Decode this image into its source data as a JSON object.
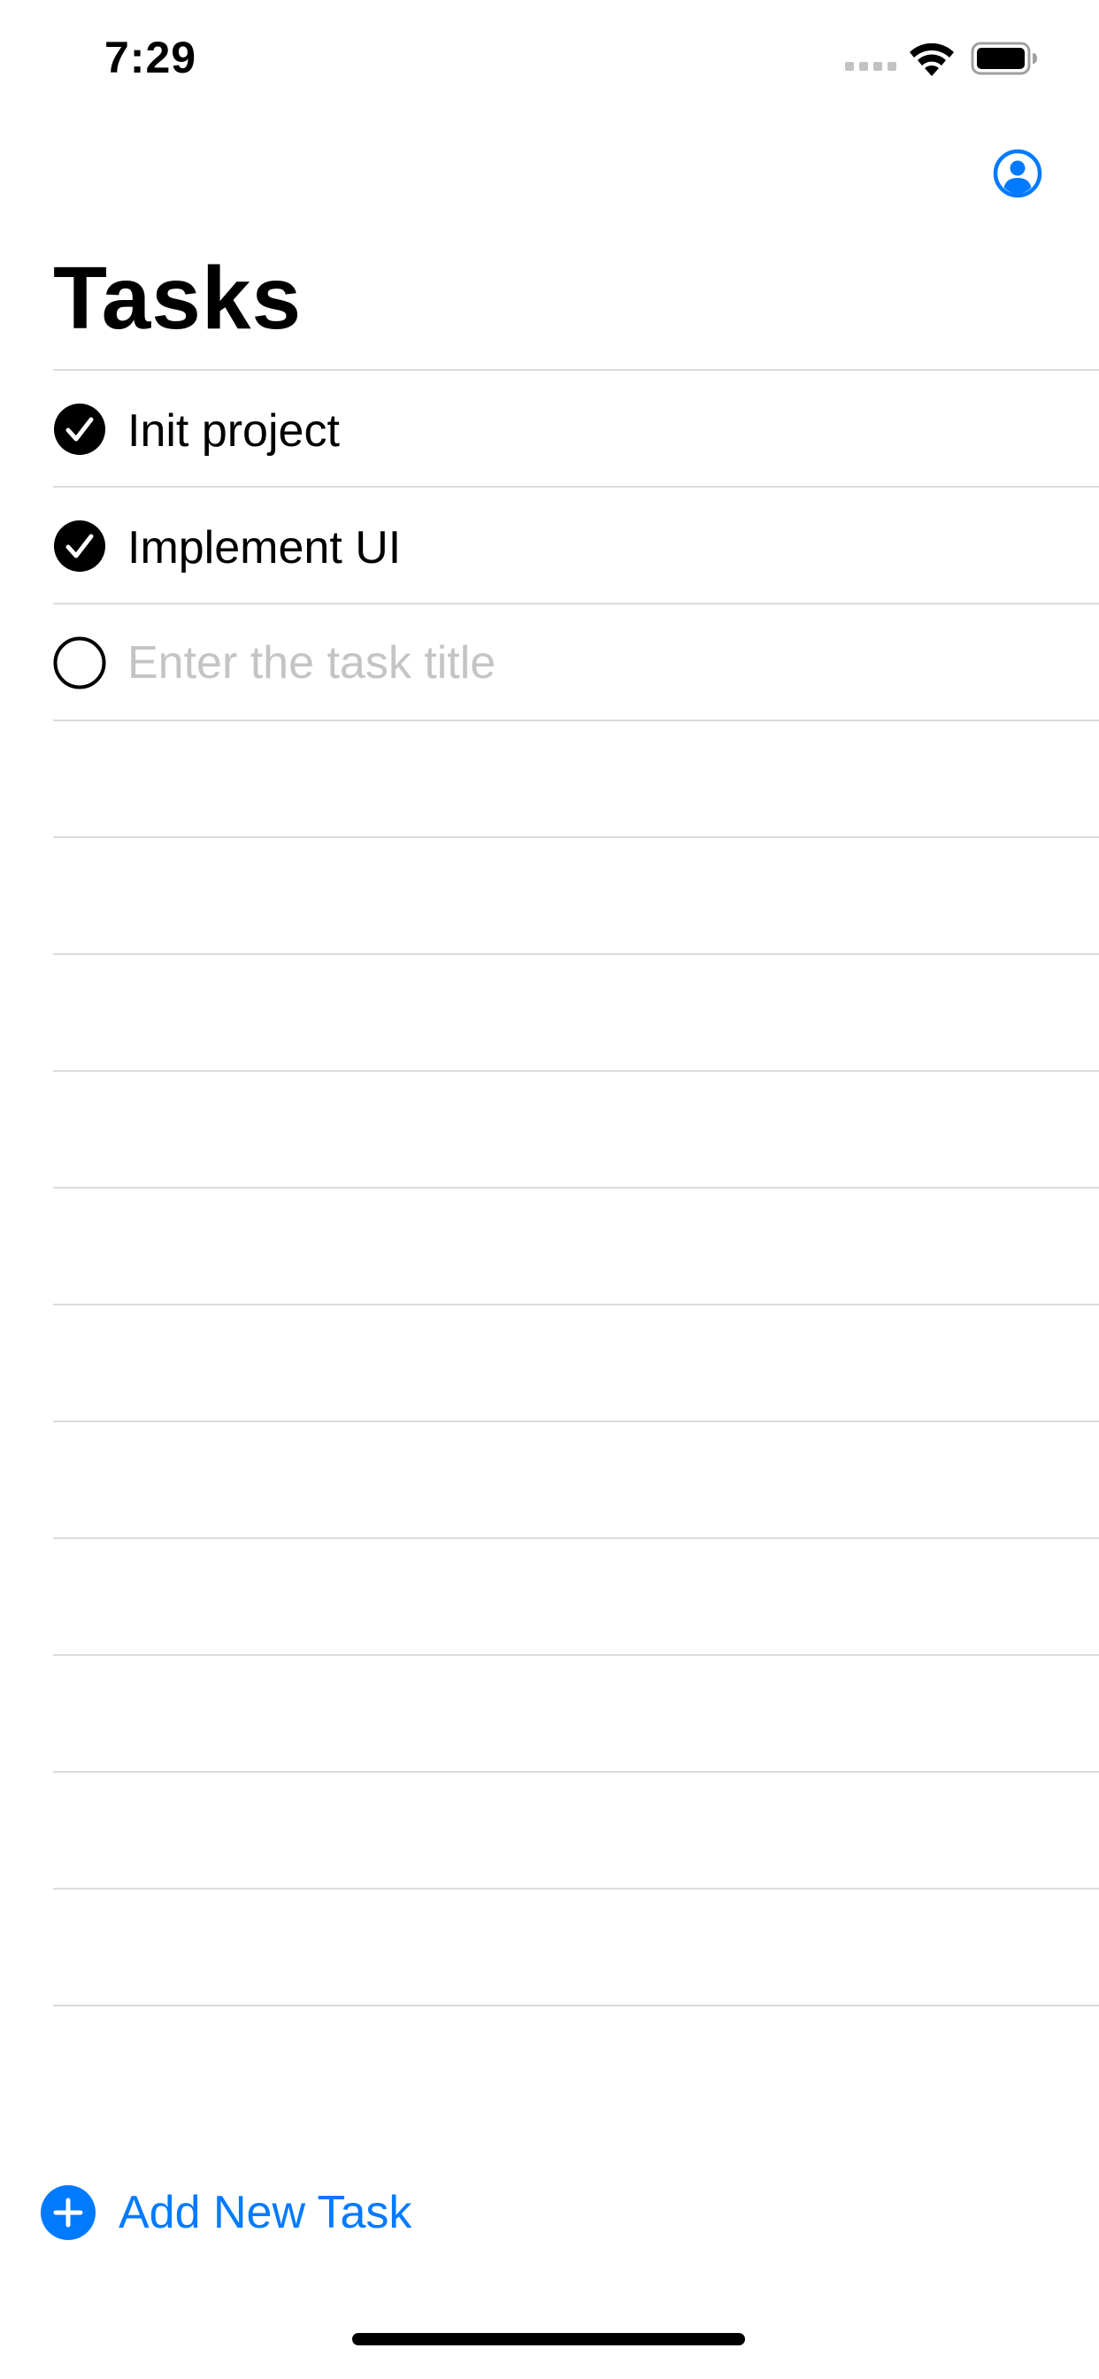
{
  "status_bar": {
    "time": "7:29",
    "icons": [
      "signal-dots-icon",
      "wifi-icon",
      "battery-icon"
    ]
  },
  "header": {
    "profile_icon": "person-circle-icon",
    "title": "Tasks"
  },
  "tasks": [
    {
      "title": "Init project",
      "completed": true
    },
    {
      "title": "Implement UI",
      "completed": true
    }
  ],
  "new_task": {
    "value": "",
    "placeholder": "Enter the task title",
    "completed": false
  },
  "add_task": {
    "label": "Add New Task",
    "icon": "plus-circle-icon"
  },
  "colors": {
    "accent": "#007aff",
    "separator": "#dcdcdc",
    "placeholder": "#c4c4c6",
    "text": "#000000",
    "background": "#ffffff"
  }
}
